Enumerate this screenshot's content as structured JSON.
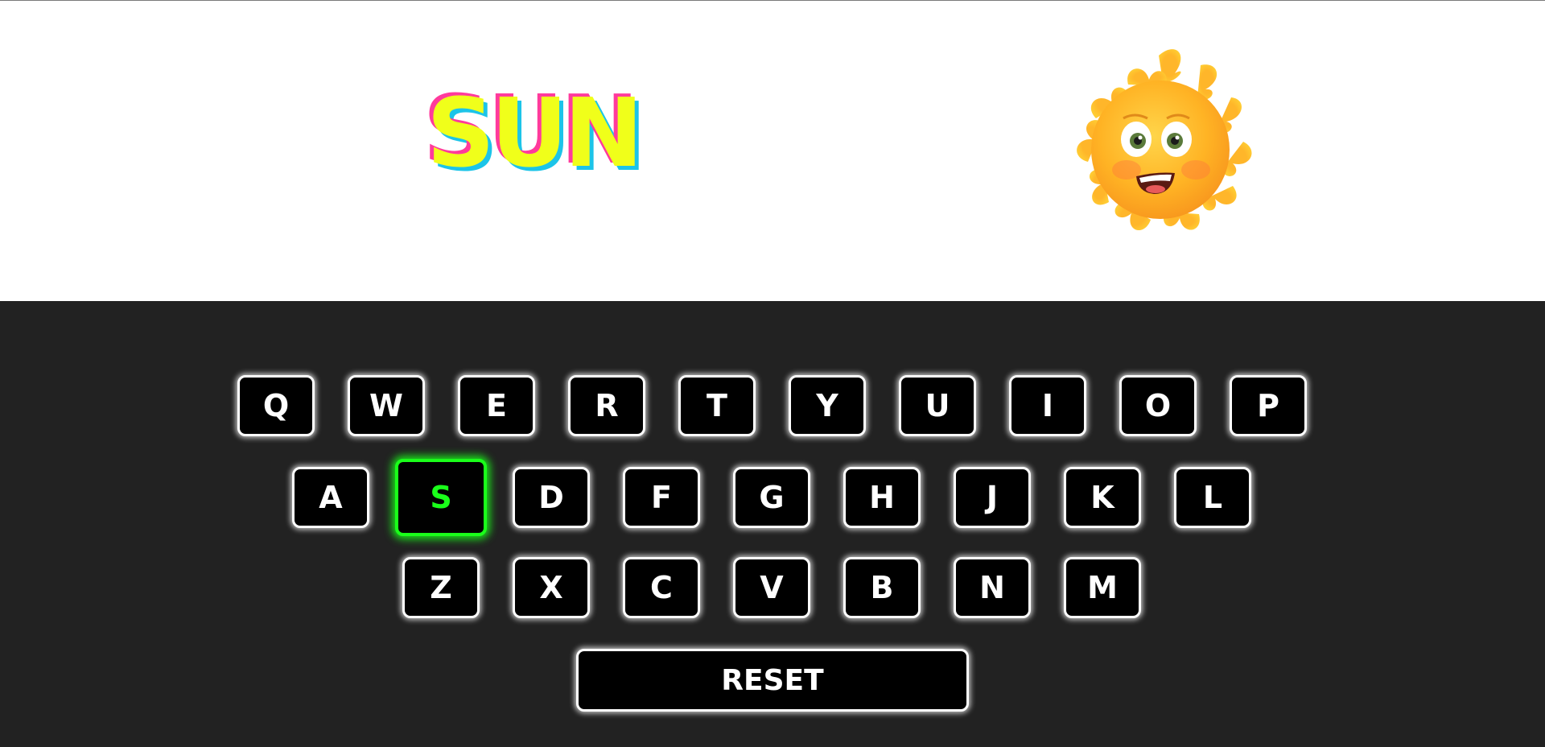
{
  "display": {
    "word": "SUN",
    "image_subject": "sun-emoji-icon",
    "word_colors": {
      "fill": "#f0ff1a",
      "shadow_pink": "#ff3a9c",
      "shadow_cyan": "#1cc4e8"
    }
  },
  "keyboard": {
    "rows": [
      [
        "Q",
        "W",
        "E",
        "R",
        "T",
        "Y",
        "U",
        "I",
        "O",
        "P"
      ],
      [
        "A",
        "S",
        "D",
        "F",
        "G",
        "H",
        "J",
        "K",
        "L"
      ],
      [
        "Z",
        "X",
        "C",
        "V",
        "B",
        "N",
        "M"
      ]
    ],
    "active_key": "S",
    "reset_label": "RESET",
    "colors": {
      "background": "#222222",
      "key": "#000000",
      "key_border": "#ffffff",
      "active": "#1aff1a"
    }
  }
}
